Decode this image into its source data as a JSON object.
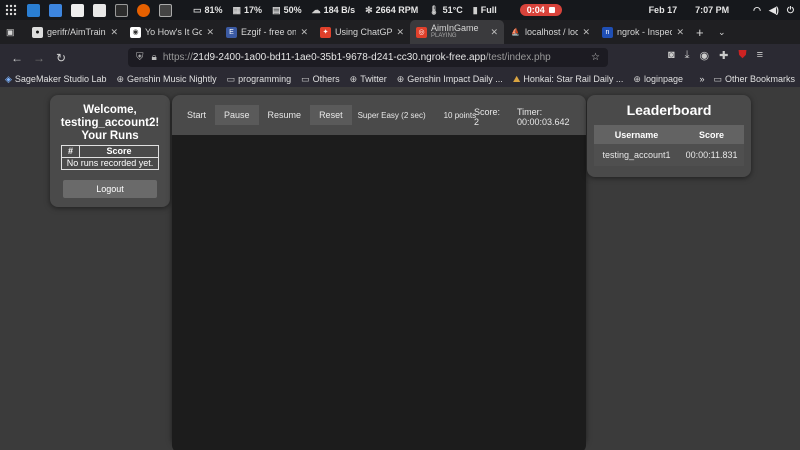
{
  "taskbar": {
    "stats": [
      {
        "icon": "battery-icon",
        "text": "81%"
      },
      {
        "icon": "cpu-icon",
        "text": "17%"
      },
      {
        "icon": "memory-icon",
        "text": "50%"
      },
      {
        "icon": "network-icon",
        "text": "184 B/s"
      },
      {
        "icon": "fan-icon",
        "text": "2664 RPM"
      },
      {
        "icon": "thermometer-icon",
        "text": "51°C"
      },
      {
        "icon": "battery-charge-icon",
        "text": "Full"
      }
    ],
    "recording": "0:04",
    "date": "Feb 17",
    "time": "7:07 PM"
  },
  "tabs": [
    {
      "title": "gerifr/AimTraine",
      "favicon_color": "#e8e8e8",
      "glyph": "●"
    },
    {
      "title": "Yo How's It Goin",
      "favicon_color": "#ffffff",
      "glyph": "◉"
    },
    {
      "title": "Ezgif - free onlin",
      "favicon_color": "#3b5aa3",
      "glyph": "E"
    },
    {
      "title": "Using ChatGPT a",
      "favicon_color": "#e0402b",
      "glyph": "✦"
    },
    {
      "title": "AimInGame",
      "subtitle": "PLAYING",
      "favicon_color": "#e0402b",
      "glyph": "◎"
    },
    {
      "title": "localhost / localh",
      "favicon_color": "#f2a23a",
      "glyph": "⛵"
    },
    {
      "title": "ngrok - Inspect",
      "favicon_color": "#1f4fb5",
      "glyph": "n"
    }
  ],
  "url": {
    "prefix": "https://",
    "host": "21d9-2400-1a00-bd11-1ae0-35b1-9678-d241-cc30.ngrok-free.app",
    "path": "/test/index.php"
  },
  "bookmarks": [
    {
      "label": "SageMaker Studio Lab",
      "icon": "sagemaker-icon"
    },
    {
      "label": "Genshin Music Nightly",
      "icon": "globe-icon"
    },
    {
      "label": "programming",
      "icon": "folder-icon"
    },
    {
      "label": "Others",
      "icon": "folder-icon"
    },
    {
      "label": "Twitter",
      "icon": "globe-icon"
    },
    {
      "label": "Genshin Impact Daily ...",
      "icon": "globe-icon"
    },
    {
      "label": "Honkai: Star Rail Daily ...",
      "icon": "honkai-icon"
    },
    {
      "label": "loginpage",
      "icon": "globe-icon"
    }
  ],
  "other_bookmarks": "Other Bookmarks",
  "user_panel": {
    "welcome": "Welcome, testing_account2!",
    "runs_title": "Your Runs",
    "columns": [
      "#",
      "Score"
    ],
    "empty_message": "No runs recorded yet.",
    "logout": "Logout"
  },
  "game": {
    "buttons": [
      "Start",
      "Pause",
      "Resume",
      "Reset"
    ],
    "difficulty": "Super Easy (2 sec)",
    "points": "10 points",
    "score_label": "Score:",
    "score_value": "2",
    "timer_label": "Timer:",
    "timer_value": "00:00:03.642"
  },
  "leaderboard": {
    "title": "Leaderboard",
    "columns": [
      "Username",
      "Score"
    ],
    "rows": [
      {
        "username": "testing_account1",
        "score": "00:00:11.831"
      }
    ]
  },
  "colors": {
    "page_bg": "#3b3b3b",
    "card_bg": "#4a4a4a",
    "canvas_bg": "#1c1c1c",
    "record_red": "#d8433b"
  }
}
